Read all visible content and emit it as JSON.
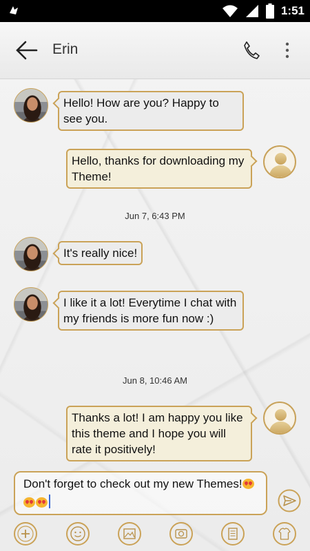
{
  "status_bar": {
    "time": "1:51",
    "icons": [
      "notification-icon",
      "wifi-icon",
      "signal-icon",
      "battery-icon"
    ]
  },
  "header": {
    "title": "Erin",
    "icons": [
      "back-arrow-icon",
      "phone-icon",
      "more-vert-icon"
    ]
  },
  "messages": [
    {
      "direction": "in",
      "text": "Hello! How are you? Happy to see you."
    },
    {
      "direction": "out",
      "text": "Hello, thanks for downloading my Theme!"
    },
    {
      "timestamp": "Jun 7, 6:43 PM"
    },
    {
      "direction": "in",
      "text": "It's really nice!"
    },
    {
      "direction": "in",
      "text": "I like it a lot! Everytime I chat with my friends is more fun now :)"
    },
    {
      "timestamp": "Jun 8, 10:46 AM"
    },
    {
      "direction": "out",
      "text": "Thanks a lot! I am happy you like this theme and I hope you will rate it positively!"
    }
  ],
  "composer": {
    "value": "Don't forget to check out my new Themes!",
    "emoji": [
      "heart-eyes-emoji",
      "kiss-emoji",
      "heart-eyes-emoji"
    ]
  },
  "toolbar": {
    "icons": [
      "add-icon",
      "emoji-icon",
      "gallery-icon",
      "camera-icon",
      "list-icon",
      "theme-icon"
    ]
  },
  "colors": {
    "accent_gold": "#caa257",
    "incoming_bubble": "#ececec",
    "outgoing_bubble": "#f4efdb"
  }
}
